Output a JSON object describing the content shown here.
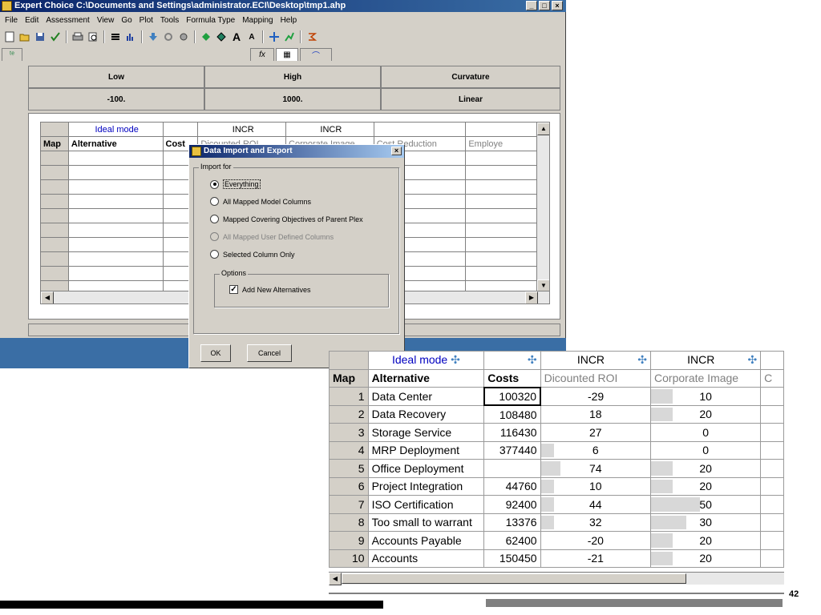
{
  "window": {
    "title": "Expert Choice   C:\\Documents and Settings\\administrator.ECI\\Desktop\\tmp1.ahp",
    "buttons": [
      "_",
      "□",
      "×"
    ]
  },
  "menubar": [
    "File",
    "Edit",
    "Assessment",
    "View",
    "Go",
    "Plot",
    "Tools",
    "Formula Type",
    "Mapping",
    "Help"
  ],
  "toolbar": {
    "icons": [
      "new-icon",
      "open-icon",
      "save-icon",
      "check-icon",
      "print-icon",
      "preview-icon",
      "bars-icon",
      "chart-icon",
      "arrow-down-icon",
      "refresh-icon",
      "settings-icon",
      "green-diamond-icon",
      "diamond-icon",
      "font-large-icon",
      "font-small-icon",
      "cross-arrows-icon",
      "graph-icon",
      "sigma-icon"
    ]
  },
  "tabs": {
    "formula_tab": "fx",
    "grid_tab": "▦",
    "curve_tab": "⌒"
  },
  "header": {
    "labels": [
      "Low",
      "High",
      "Curvature"
    ],
    "values": [
      "-100.",
      "1000.",
      "Linear"
    ]
  },
  "bg_grid": {
    "row1": [
      "",
      "Ideal mode",
      "",
      "INCR",
      "INCR",
      "",
      ""
    ],
    "row2": [
      "Map",
      "Alternative",
      "Cost",
      "Dicounted ROI",
      "Corporate Image",
      "Cost Reduction",
      "Employe"
    ]
  },
  "dialog": {
    "title": "Data Import and Export",
    "group_label": "Import for",
    "options": [
      "Everything",
      "All Mapped Model Columns",
      "Mapped Covering Objectives of Parent Plex",
      "All Mapped User Defined Columns",
      "Selected Column Only"
    ],
    "options_label": "Options",
    "checkbox_label": "Add New Alternatives",
    "ok": "OK",
    "cancel": "Cancel"
  },
  "zoom": {
    "header1": [
      "",
      "Ideal mode",
      "",
      "INCR",
      "INCR",
      ""
    ],
    "header2": [
      "Map",
      "Alternative",
      "Costs",
      "Dicounted ROI",
      "Corporate Image",
      "C"
    ],
    "rows": [
      {
        "map": "1",
        "alt": "Data Center",
        "cost": "100320",
        "roi": "-29",
        "img": "10",
        "roi_level": 0.0,
        "img_level": 0.2
      },
      {
        "map": "2",
        "alt": "Data Recovery",
        "cost": "108480",
        "roi": "18",
        "img": "20",
        "roi_level": 0.0,
        "img_level": 0.2
      },
      {
        "map": "3",
        "alt": "Storage Service",
        "cost": "116430",
        "roi": "27",
        "img": "0",
        "roi_level": 0.0,
        "img_level": 0.0
      },
      {
        "map": "4",
        "alt": "MRP Deployment",
        "cost": "377440",
        "roi": "6",
        "img": "0",
        "roi_level": 0.12,
        "img_level": 0.0
      },
      {
        "map": "5",
        "alt": "Office Deployment",
        "cost": "",
        "roi": "74",
        "img": "20",
        "roi_level": 0.18,
        "img_level": 0.2
      },
      {
        "map": "6",
        "alt": "Project Integration",
        "cost": "44760",
        "roi": "10",
        "img": "20",
        "roi_level": 0.12,
        "img_level": 0.2
      },
      {
        "map": "7",
        "alt": "ISO Certification",
        "cost": "92400",
        "roi": "44",
        "img": "50",
        "roi_level": 0.12,
        "img_level": 0.45
      },
      {
        "map": "8",
        "alt": "Too small to warrant",
        "cost": "13376",
        "roi": "32",
        "img": "30",
        "roi_level": 0.12,
        "img_level": 0.32
      },
      {
        "map": "9",
        "alt": "Accounts Payable",
        "cost": "62400",
        "roi": "-20",
        "img": "20",
        "roi_level": 0.0,
        "img_level": 0.2
      },
      {
        "map": "10",
        "alt": "Accounts",
        "cost": "150450",
        "roi": "-21",
        "img": "20",
        "roi_level": 0.0,
        "img_level": 0.2
      }
    ]
  },
  "slide_number": "42"
}
